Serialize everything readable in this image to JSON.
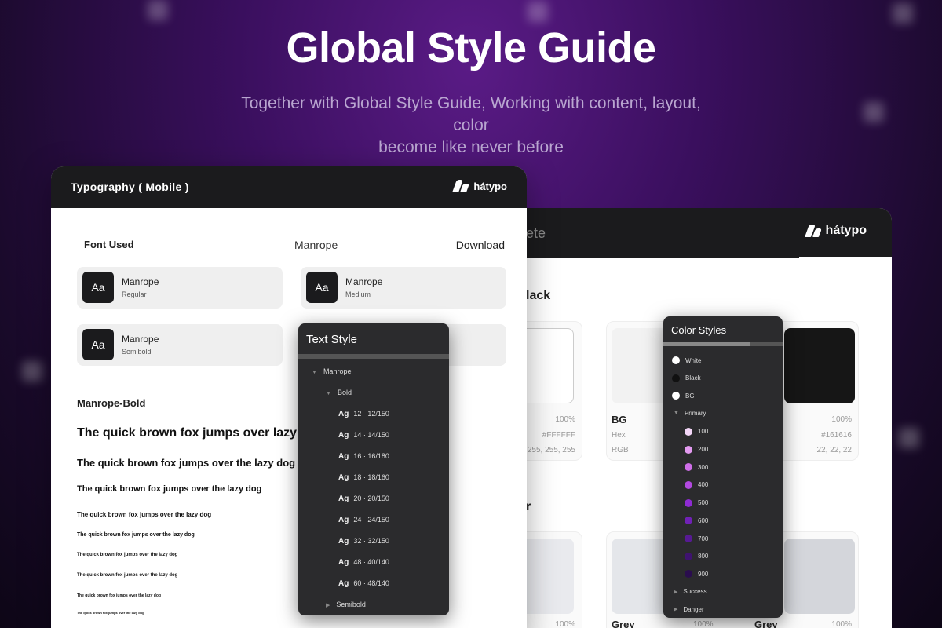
{
  "hero": {
    "title": "Global Style Guide",
    "subtitle_line1": "Together with Global Style Guide, Working with content, layout, color",
    "subtitle_line2": "become like never before"
  },
  "brand": {
    "logo_text": "hátypo"
  },
  "typography_card": {
    "title": "Typography ( Mobile )",
    "font_used_label": "Font Used",
    "font_name": "Manrope",
    "download_label": "Download",
    "tiles": [
      {
        "aa": "Aa",
        "name": "Manrope",
        "weight": "Regular"
      },
      {
        "aa": "Aa",
        "name": "Manrope",
        "weight": "Medium"
      },
      {
        "aa": "Aa",
        "name": "Manrope",
        "weight": "Semibold"
      }
    ],
    "style_heading": "Manrope-Bold",
    "samples": [
      "The quick brown fox jumps over lazy",
      "The quick brown fox jumps over the lazy dog",
      "The quick brown fox jumps over the lazy dog",
      "The quick brown fox jumps over the lazy dog",
      "The quick brown fox jumps over the lazy dog",
      "The quick brown fox jumps over the lazy dog",
      "The quick brown fox jumps over the lazy dog",
      "The quick brown fox jumps over the lazy dog",
      "The quick brown fox jumps over the lazy dog"
    ]
  },
  "text_style_panel": {
    "title": "Text Style",
    "family": "Manrope",
    "group_bold": "Bold",
    "ag_label": "Ag",
    "entries": [
      "12 · 12/150",
      "14 · 14/150",
      "16 · 16/180",
      "18 · 18/160",
      "20 · 20/150",
      "24 · 24/150",
      "32 · 32/150",
      "48 · 40/140",
      "60 · 48/140"
    ],
    "group_semibold": "Semibold"
  },
  "palette_card": {
    "title_partial": "ete",
    "section1_partial": "lack",
    "section2_partial": "r",
    "swatch_left": {
      "pct": "100%",
      "hex": "#FFFFFF",
      "rgb": "255, 255, 255"
    },
    "swatch_bg": {
      "name": "BG",
      "pct": "100%",
      "hex_label": "Hex",
      "hex": "#161616",
      "rgb_label": "RGB",
      "rgb": "22, 22, 22"
    },
    "grey_left": {
      "pct": "100%"
    },
    "grey_mid": {
      "name": "Grey",
      "pct": "100%"
    },
    "grey_right": {
      "name": "Grey",
      "pct": "100%"
    }
  },
  "color_styles_panel": {
    "title": "Color Styles",
    "items": [
      {
        "label": "White",
        "color": "#ffffff"
      },
      {
        "label": "Black",
        "color": "#111111"
      },
      {
        "label": "BG",
        "color": "#ffffff"
      }
    ],
    "primary_label": "Primary",
    "primary": [
      {
        "label": "100",
        "color": "#f3d6f7"
      },
      {
        "label": "200",
        "color": "#e39af0"
      },
      {
        "label": "300",
        "color": "#cf6ee8"
      },
      {
        "label": "400",
        "color": "#b249e0"
      },
      {
        "label": "500",
        "color": "#8f2bd3"
      },
      {
        "label": "600",
        "color": "#7021b5"
      },
      {
        "label": "700",
        "color": "#571a93"
      },
      {
        "label": "800",
        "color": "#3f1370"
      },
      {
        "label": "900",
        "color": "#2a0d4e"
      }
    ],
    "success_label": "Success",
    "danger_label": "Danger"
  }
}
